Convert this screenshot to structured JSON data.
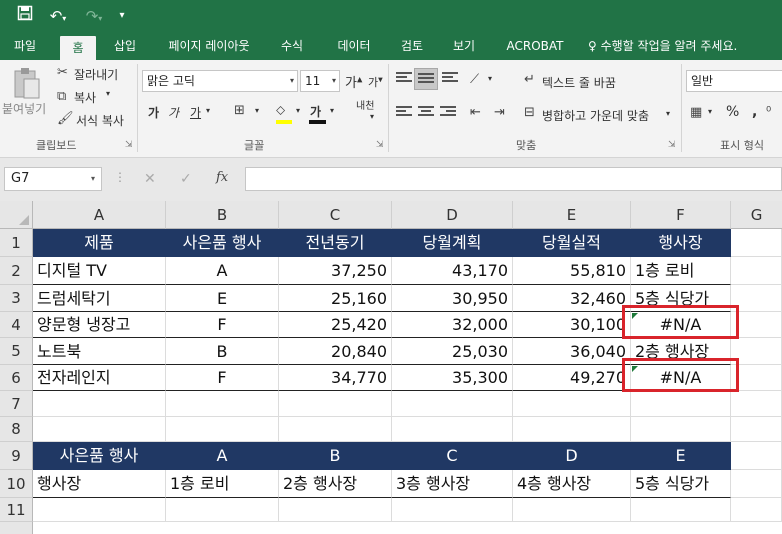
{
  "quick_access": [
    "save-icon",
    "undo-icon",
    "redo-icon",
    "customize-icon"
  ],
  "tabs": [
    "파일",
    "홈",
    "삽입",
    "페이지 레이아웃",
    "수식",
    "데이터",
    "검토",
    "보기",
    "ACROBAT"
  ],
  "tell_me": "♀ 수행할 작업을 알려 주세요.",
  "clipboard": {
    "paste": "붙여넣기",
    "cut": "잘라내기",
    "copy": "복사",
    "format_painter": "서식 복사",
    "group": "클립보드"
  },
  "font": {
    "name": "맑은 고딕",
    "size": "11",
    "group": "글꼴",
    "bold": "가",
    "italic": "가",
    "underline": "가",
    "phonetic": "내천"
  },
  "alignment": {
    "wrap": "텍스트 줄 바꿈",
    "merge": "병합하고 가운데 맞춤",
    "group": "맞춤"
  },
  "number": {
    "format": "일반",
    "group": "표시 형식"
  },
  "formula_bar": {
    "name_box": "G7",
    "fx": "fx",
    "formula": ""
  },
  "columns": [
    "A",
    "B",
    "C",
    "D",
    "E",
    "F",
    "G"
  ],
  "rows": [
    "1",
    "2",
    "3",
    "4",
    "5",
    "6",
    "7",
    "8",
    "9",
    "10",
    "11"
  ],
  "table1": {
    "header": [
      "제품",
      "사은품 행사",
      "전년동기",
      "당월계획",
      "당월실적",
      "행사장"
    ],
    "rows": [
      [
        "디지털 TV",
        "A",
        "37,250",
        "43,170",
        "55,810",
        "1층 로비"
      ],
      [
        "드럼세탁기",
        "E",
        "25,160",
        "30,950",
        "32,460",
        "5층 식당가"
      ],
      [
        "양문형 냉장고",
        "F",
        "25,420",
        "32,000",
        "30,100",
        "#N/A"
      ],
      [
        "노트북",
        "B",
        "20,840",
        "25,030",
        "36,040",
        "2층 행사장"
      ],
      [
        "전자레인지",
        "F",
        "34,770",
        "35,300",
        "49,270",
        "#N/A"
      ]
    ]
  },
  "table2": {
    "header": [
      "사은품 행사",
      "A",
      "B",
      "C",
      "D",
      "E"
    ],
    "row": [
      "행사장",
      "1층 로비",
      "2층 행사장",
      "3층 행사장",
      "4층 행사장",
      "5층 식당가"
    ]
  },
  "colors": {
    "excel_green": "#217346",
    "header_navy": "#203864",
    "highlight_red": "#d9242b"
  }
}
